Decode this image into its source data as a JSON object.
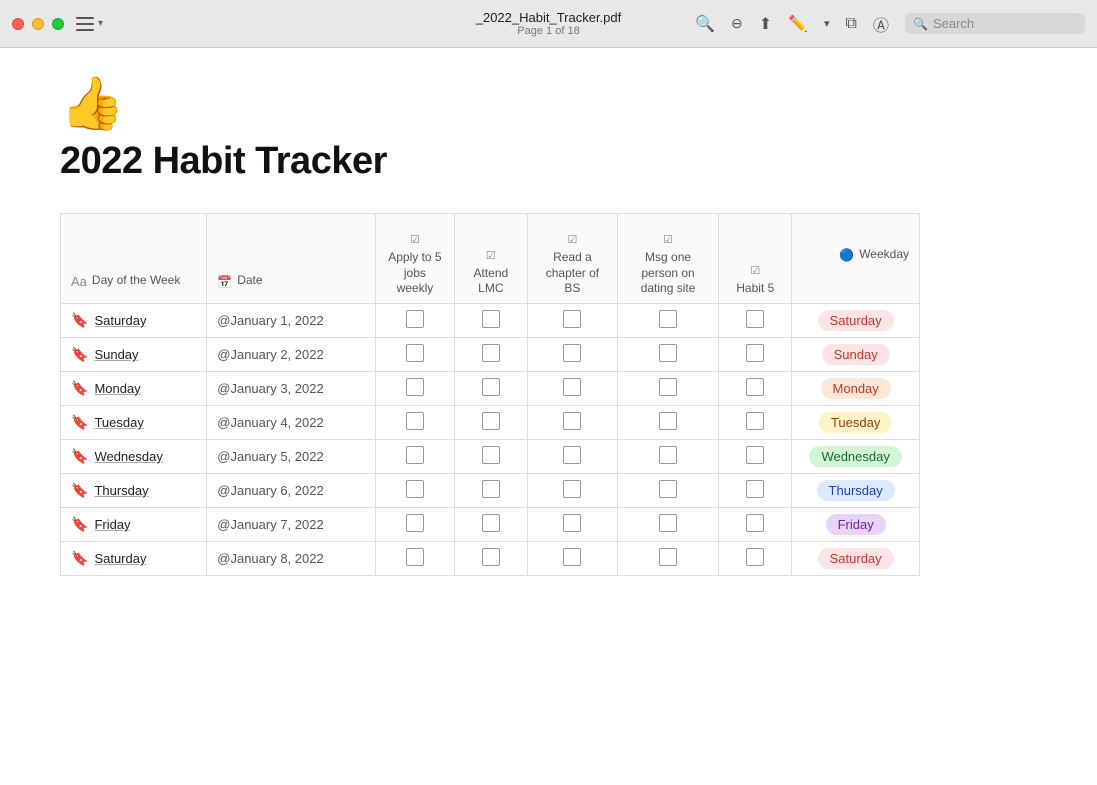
{
  "titlebar": {
    "filename": "_2022_Habit_Tracker.pdf",
    "page_info": "Page 1 of 18"
  },
  "toolbar": {
    "search_placeholder": "Search"
  },
  "page": {
    "emoji": "👍",
    "title": "2022 Habit Tracker"
  },
  "table": {
    "headers": {
      "day_of_week": "Day of the Week",
      "date": "Date",
      "apply_to_5_jobs": "Apply to 5 jobs weekly",
      "attend_lmc": "Attend LMC",
      "read_chapter": "Read a chapter of BS",
      "msg_person": "Msg one person on dating site",
      "habit5": "Habit 5",
      "weekday": "Weekday"
    },
    "rows": [
      {
        "day": "Saturday",
        "date": "@January 1, 2022",
        "weekday": "Saturday",
        "badge_class": "badge-saturday"
      },
      {
        "day": "Sunday",
        "date": "@January 2, 2022",
        "weekday": "Sunday",
        "badge_class": "badge-sunday"
      },
      {
        "day": "Monday",
        "date": "@January 3, 2022",
        "weekday": "Monday",
        "badge_class": "badge-monday"
      },
      {
        "day": "Tuesday",
        "date": "@January 4, 2022",
        "weekday": "Tuesday",
        "badge_class": "badge-tuesday"
      },
      {
        "day": "Wednesday",
        "date": "@January 5, 2022",
        "weekday": "Wednesday",
        "badge_class": "badge-wednesday"
      },
      {
        "day": "Thursday",
        "date": "@January 6, 2022",
        "weekday": "Thursday",
        "badge_class": "badge-thursday"
      },
      {
        "day": "Friday",
        "date": "@January 7, 2022",
        "weekday": "Friday",
        "badge_class": "badge-friday"
      },
      {
        "day": "Saturday",
        "date": "@January 8, 2022",
        "weekday": "Saturday",
        "badge_class": "badge-saturday"
      }
    ]
  }
}
